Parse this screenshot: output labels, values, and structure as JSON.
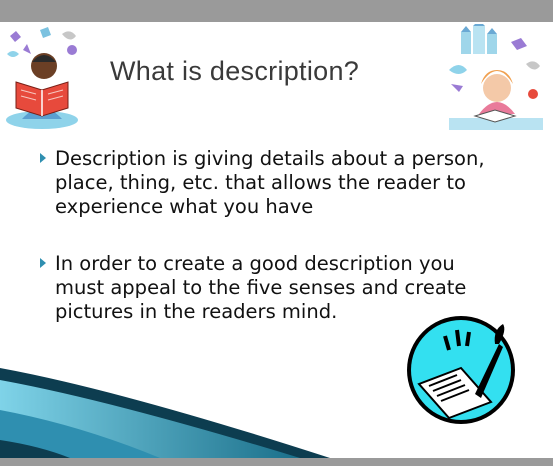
{
  "slide": {
    "title": "What is description?",
    "bullets": [
      {
        "text": "Description is giving details about a person, place, thing, etc. that allows the reader to experience what you have"
      },
      {
        "text": "In order to create a good description you must appeal to the five senses and create pictures in the readers mind."
      }
    ]
  },
  "icons": {
    "bullet": "triangle-right-icon",
    "left_clipart": "reading-boy-clipart",
    "right_clipart": "dreaming-girl-clipart",
    "bottom_clipart": "writing-paper-quill-clipart"
  },
  "colors": {
    "frame": "#9a9a9a",
    "accent": "#2f8fb0",
    "swoosh_dark": "#0d3d50",
    "swoosh_light": "#7fd3e8",
    "circle_fill": "#33e0f0"
  }
}
